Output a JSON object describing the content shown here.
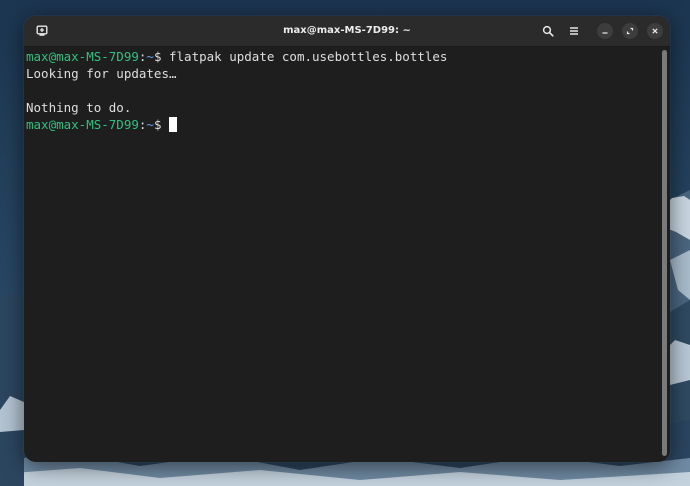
{
  "window": {
    "title": "max@max-MS-7D99: ~"
  },
  "headerbar": {
    "icons": {
      "new_tab": "new-tab-icon",
      "search": "search-icon",
      "menu": "hamburger-menu-icon",
      "minimize": "minimize-icon",
      "maximize": "maximize-icon",
      "close": "close-icon"
    }
  },
  "terminal": {
    "lines": [
      {
        "user_host": "max@max-MS-7D99",
        "separator": ":",
        "path": "~",
        "symbol": "$",
        "command": " flatpak update com.usebottles.bottles"
      },
      {
        "text": "Looking for updates…"
      },
      {
        "text": ""
      },
      {
        "text": "Nothing to do."
      },
      {
        "user_host": "max@max-MS-7D99",
        "separator": ":",
        "path": "~",
        "symbol": "$",
        "command": " "
      }
    ]
  },
  "colors": {
    "prompt_user": "#2ec27e",
    "prompt_path": "#62a0ea",
    "terminal_bg": "#1e1e1e",
    "headerbar_bg": "#2b2b2b",
    "text": "#dedede"
  }
}
